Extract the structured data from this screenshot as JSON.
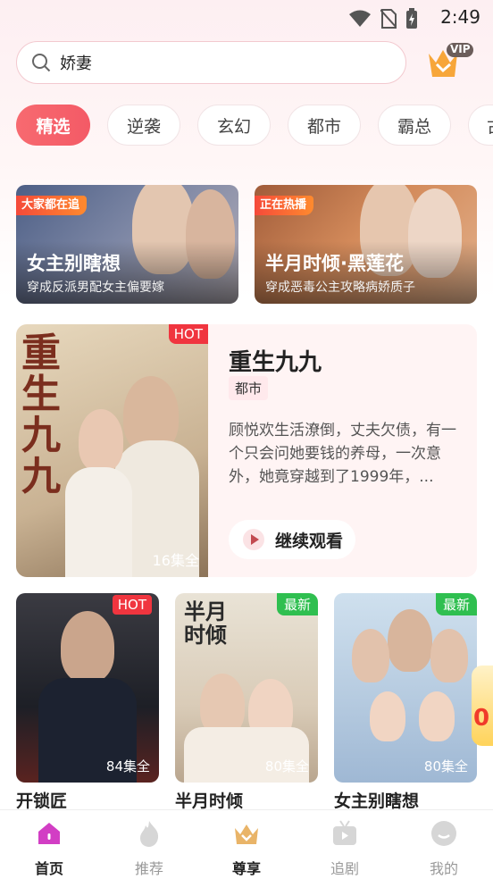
{
  "status": {
    "time": "2:49"
  },
  "search": {
    "query": "娇妻",
    "vip_label": "VIP"
  },
  "tabs": [
    "精选",
    "逆袭",
    "玄幻",
    "都市",
    "霸总",
    "古"
  ],
  "banners": [
    {
      "badge": "大家都在追",
      "title": "女主别瞎想",
      "subtitle": "穿成反派男配女主偏要嫁"
    },
    {
      "badge": "正在热播",
      "title": "半月时倾·黑莲花",
      "subtitle": "穿成恶毒公主攻略病娇质子"
    }
  ],
  "featured": {
    "hot": "HOT",
    "poster_text": "重生九九",
    "episodes": "16集全",
    "title": "重生九九",
    "tag": "都市",
    "description": "顾悦欢生活潦倒，丈夫欠债，有一个只会问她要钱的养母，一次意外，她竟穿越到了1999年，...",
    "button": "继续观看"
  },
  "grid": [
    {
      "badge": "HOT",
      "episodes": "84集全",
      "title": "开锁匠"
    },
    {
      "badge": "最新",
      "episodes": "80集全",
      "title": "半月时倾"
    },
    {
      "badge": "最新",
      "episodes": "80集全",
      "title": "女主别瞎想"
    }
  ],
  "float_promo": "0",
  "nav": [
    {
      "label": "首页",
      "icon": "home-icon"
    },
    {
      "label": "推荐",
      "icon": "flame-icon"
    },
    {
      "label": "尊享",
      "icon": "crown-icon"
    },
    {
      "label": "追剧",
      "icon": "tv-icon"
    },
    {
      "label": "我的",
      "icon": "profile-icon"
    }
  ],
  "colors": {
    "accent": "#f45a66",
    "hot": "#f0353f",
    "new": "#2fbf50"
  }
}
